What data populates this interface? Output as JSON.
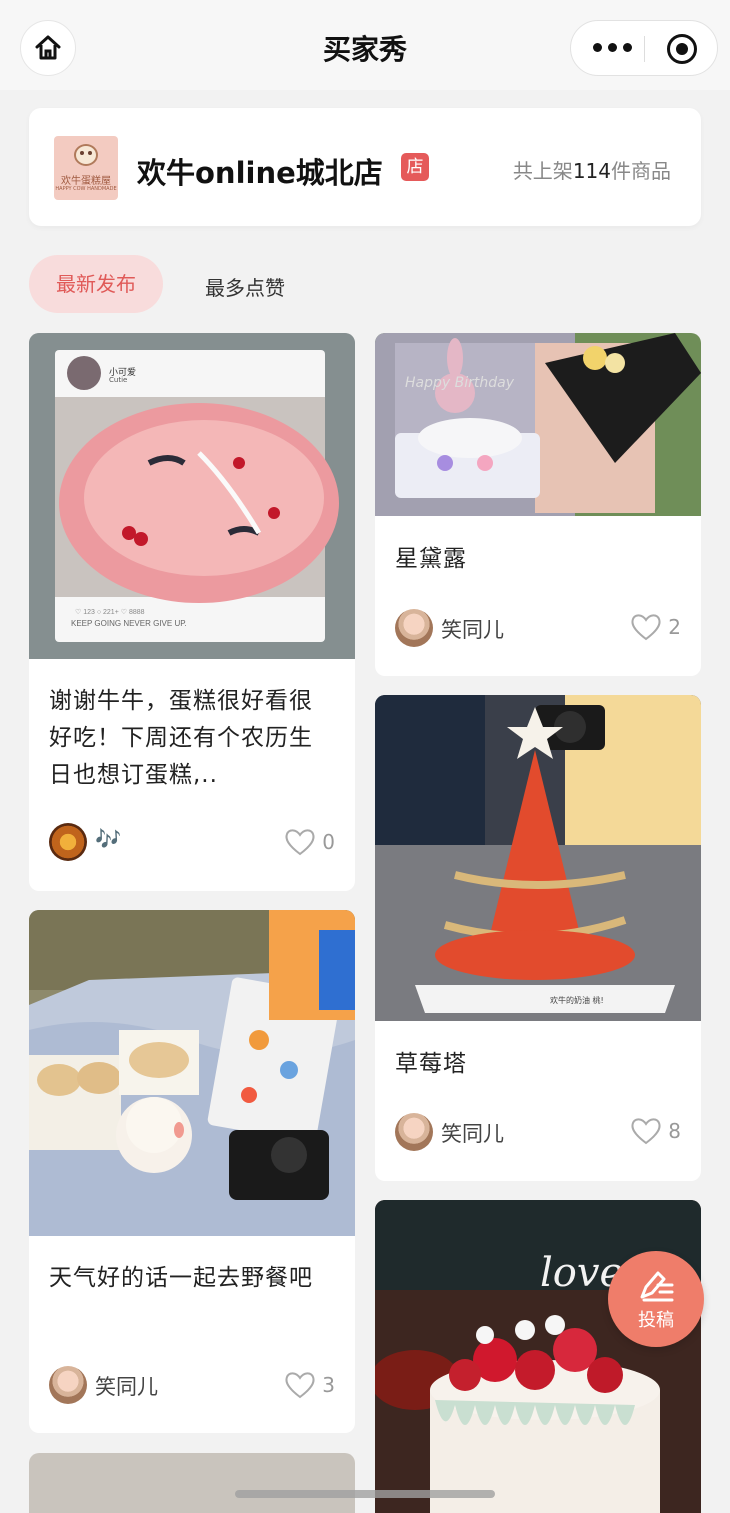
{
  "nav": {
    "title": "买家秀"
  },
  "store": {
    "logo_text": "欢牛蛋糕屋",
    "logo_sub": "HAPPY COW HANDMADE",
    "name": "欢牛online城北店",
    "tag": "店",
    "count_prefix": "共上架",
    "count_number": "114",
    "count_suffix": "件商品"
  },
  "filters": {
    "active": "最新发布",
    "other": "最多点赞"
  },
  "posts": [
    {
      "caption": "谢谢牛牛，蛋糕很好看很好吃！下周还有个农历生日也想订蛋糕,..",
      "author": "🎶",
      "likes": "0",
      "img_label": "KEEP GOING NEVER GIVE UP.",
      "img_user": "小可爱",
      "img_user_sub": "Cutie"
    },
    {
      "caption": "天气好的话一起去野餐吧",
      "author": "笑同儿",
      "likes": "3"
    },
    {
      "caption": "星黛露",
      "author": "笑同儿",
      "likes": "2",
      "img_label": "Happy Birthday"
    },
    {
      "caption": "草莓塔",
      "author": "笑同儿",
      "likes": "8",
      "img_label": "欢牛的奶油 桃!"
    },
    {
      "img_label": "love"
    }
  ],
  "float_button": {
    "label": "投稿"
  },
  "colors": {
    "accent": "#e05a58",
    "tab_bg": "#f8dcdc",
    "float_bg": "#ef7d6a",
    "store_tag": "#e55a5a"
  },
  "icons": {
    "home": "home-icon",
    "more": "more-dots-icon",
    "close": "target-icon",
    "heart": "heart-outline-icon",
    "pen": "pen-edit-icon"
  }
}
